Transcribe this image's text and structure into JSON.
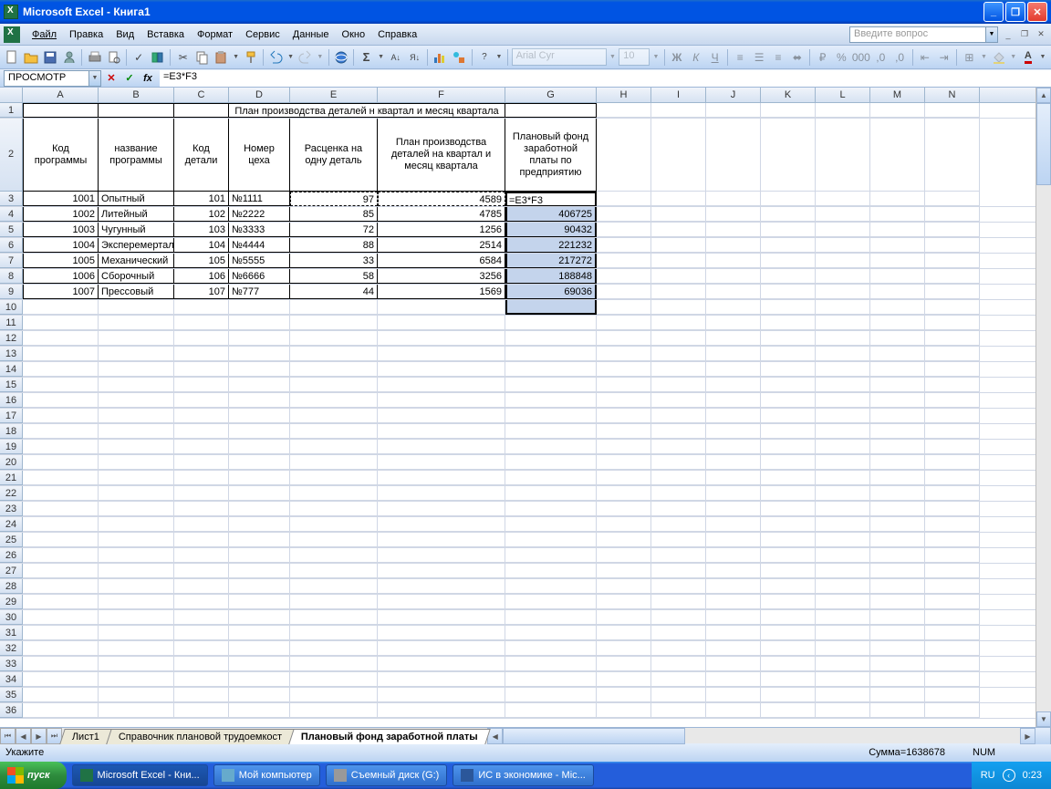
{
  "title": "Microsoft Excel - Книга1",
  "menu": [
    "Файл",
    "Правка",
    "Вид",
    "Вставка",
    "Формат",
    "Сервис",
    "Данные",
    "Окно",
    "Справка"
  ],
  "help_placeholder": "Введите вопрос",
  "font_name": "Arial Cyr",
  "font_size": "10",
  "name_box": "ПРОСМОТР",
  "formula": "=E3*F3",
  "columns": [
    "A",
    "B",
    "C",
    "D",
    "E",
    "F",
    "G",
    "H",
    "I",
    "J",
    "K",
    "L",
    "M",
    "N"
  ],
  "table_title": "План производства деталей н квартал и месяц квартала",
  "headers": {
    "A": "Код программы",
    "B": "название программы",
    "C": "Код детали",
    "D": "Номер цеха",
    "E": "Расценка на одну деталь",
    "F": "План производства деталей на квартал и месяц квартала",
    "G": "Плановый фонд заработной платы по предприятию"
  },
  "rows": [
    {
      "A": "1001",
      "B": "Опытный",
      "C": "101",
      "D": "№1111",
      "E": "97",
      "F": "4589",
      "G": "=E3*F3"
    },
    {
      "A": "1002",
      "B": "Литейный",
      "C": "102",
      "D": "№2222",
      "E": "85",
      "F": "4785",
      "G": "406725"
    },
    {
      "A": "1003",
      "B": "Чугунный",
      "C": "103",
      "D": "№3333",
      "E": "72",
      "F": "1256",
      "G": "90432"
    },
    {
      "A": "1004",
      "B": "Эксперемертальный",
      "C": "104",
      "D": "№4444",
      "E": "88",
      "F": "2514",
      "G": "221232"
    },
    {
      "A": "1005",
      "B": "Механический",
      "C": "105",
      "D": "№5555",
      "E": "33",
      "F": "6584",
      "G": "217272"
    },
    {
      "A": "1006",
      "B": "Сборочный",
      "C": "106",
      "D": "№6666",
      "E": "58",
      "F": "3256",
      "G": "188848"
    },
    {
      "A": "1007",
      "B": "Прессовый",
      "C": "107",
      "D": "№777",
      "E": "44",
      "F": "1569",
      "G": "69036"
    }
  ],
  "sheets": [
    "Лист1",
    "Справочник плановой трудоемкост",
    "Плановый фонд заработной платы"
  ],
  "active_sheet": 2,
  "status_left": "Укажите",
  "status_sum": "Сумма=1638678",
  "status_num": "NUM",
  "taskbar": {
    "start": "пуск",
    "tasks": [
      "Microsoft Excel - Кни...",
      "Мой компьютер",
      "Съемный диск (G:)",
      "ИС в экономике - Mic..."
    ],
    "lang": "RU",
    "time": "0:23"
  }
}
